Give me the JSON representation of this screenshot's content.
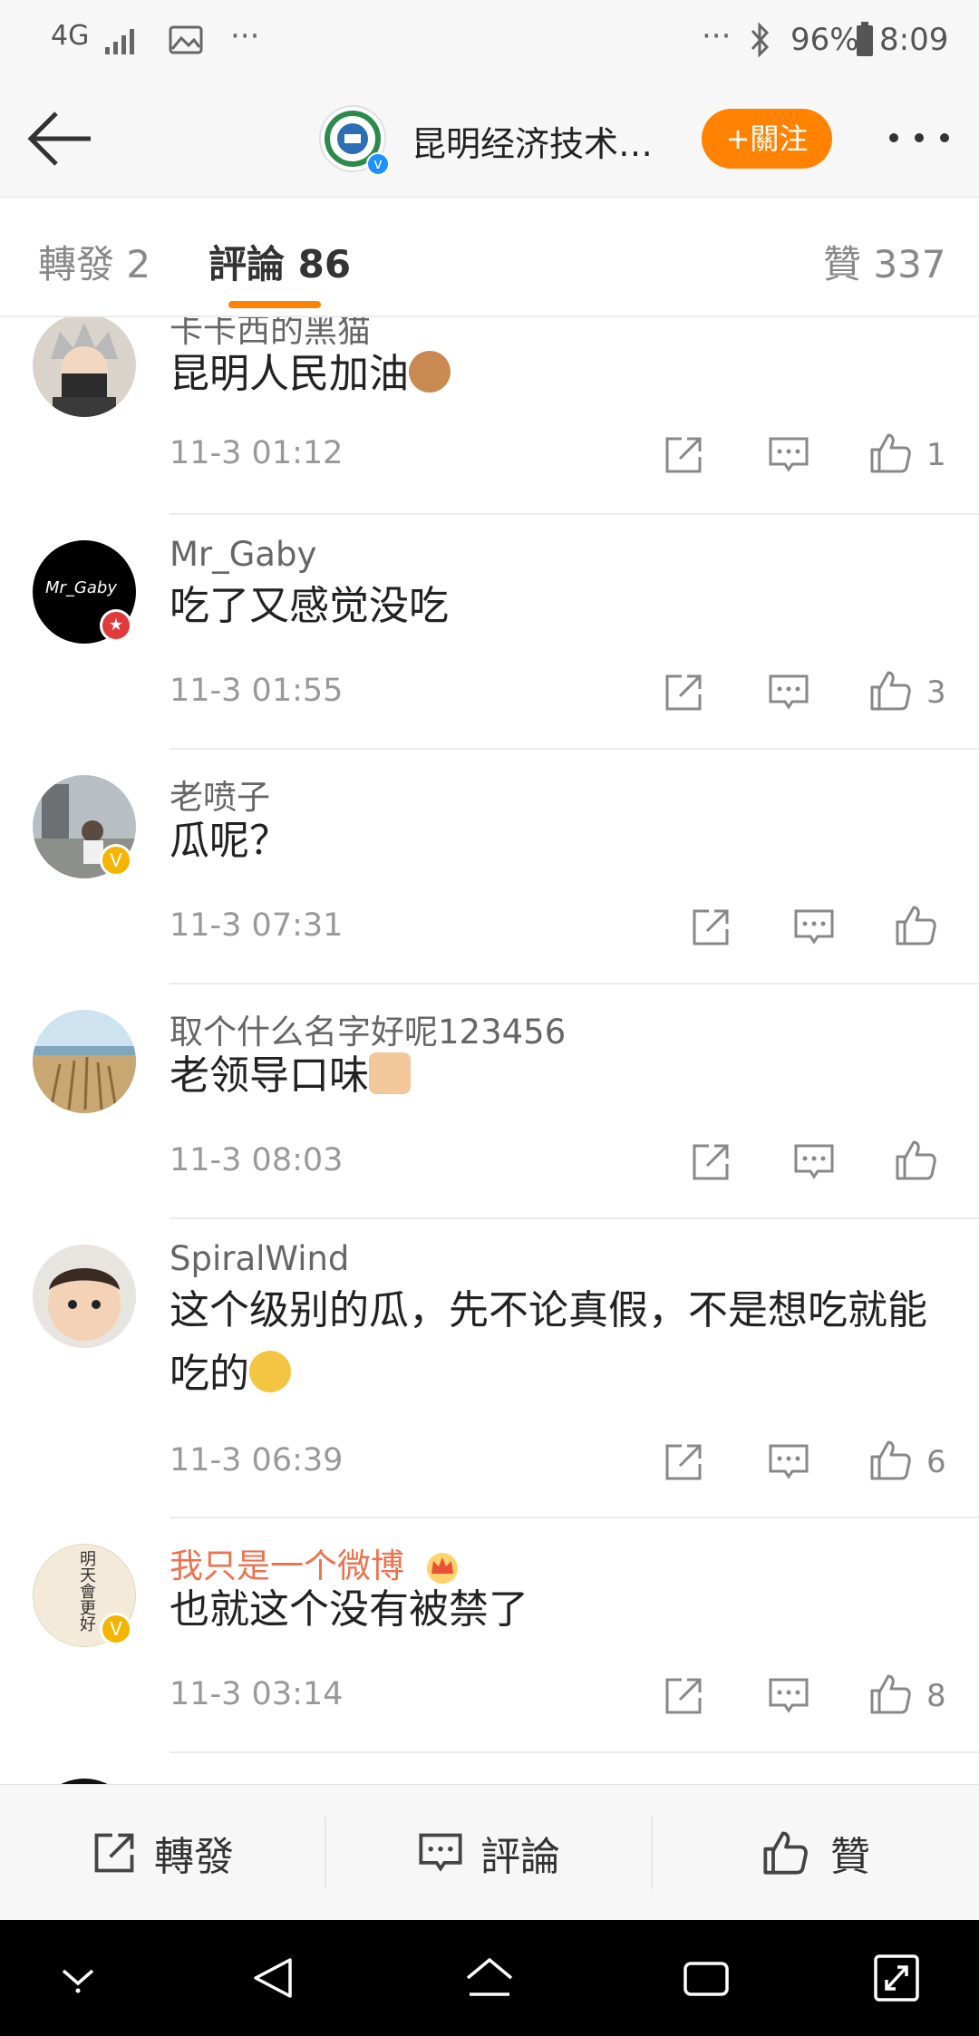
{
  "status_bar": {
    "network": "4G",
    "battery": "96%",
    "time": "8:09"
  },
  "header": {
    "account_name": "昆明经济技术…",
    "follow_label": "+關注"
  },
  "tabs": {
    "repost": "轉發 2",
    "comments": "評論 86",
    "likes": "贊 337"
  },
  "comments": [
    {
      "user": "卡卡西的黑猫",
      "text": "昆明人民加油",
      "emoji": "mouse-face-emoji",
      "time": "11-3 01:12",
      "likes": "1"
    },
    {
      "user": "Mr_Gaby",
      "text": "吃了又感觉没吃",
      "time": "11-3 01:55",
      "likes": "3",
      "avatar_text": "Mr_Gaby"
    },
    {
      "user": "老喷子",
      "text": "瓜呢？",
      "time": "11-3 07:31",
      "likes": ""
    },
    {
      "user": "取个什么名字好呢123456",
      "text": "老领导口味",
      "emoji": "thumbs-up-emoji",
      "time": "11-3 08:03",
      "likes": ""
    },
    {
      "user": "SpiralWind",
      "text": "这个级别的瓜，先不论真假，不是想吃就能吃的",
      "emoji": "thinking-emoji",
      "time": "11-3 06:39",
      "likes": "6"
    },
    {
      "user": "我只是一个微博",
      "text": "也就这个没有被禁了",
      "time": "11-3 03:14",
      "likes": "8",
      "avatar_text": "明天會更好"
    }
  ],
  "bottom_bar": {
    "repost_label": "轉發",
    "comment_label": "評論",
    "like_label": "贊"
  },
  "colors": {
    "accent_orange": "#ff8200",
    "vip_name": "#eb7350",
    "verified_yellow": "#f5b400"
  },
  "icons": [
    "back-arrow-icon",
    "more-icon",
    "share-icon",
    "comment-icon",
    "like-icon",
    "bluetooth-icon"
  ]
}
